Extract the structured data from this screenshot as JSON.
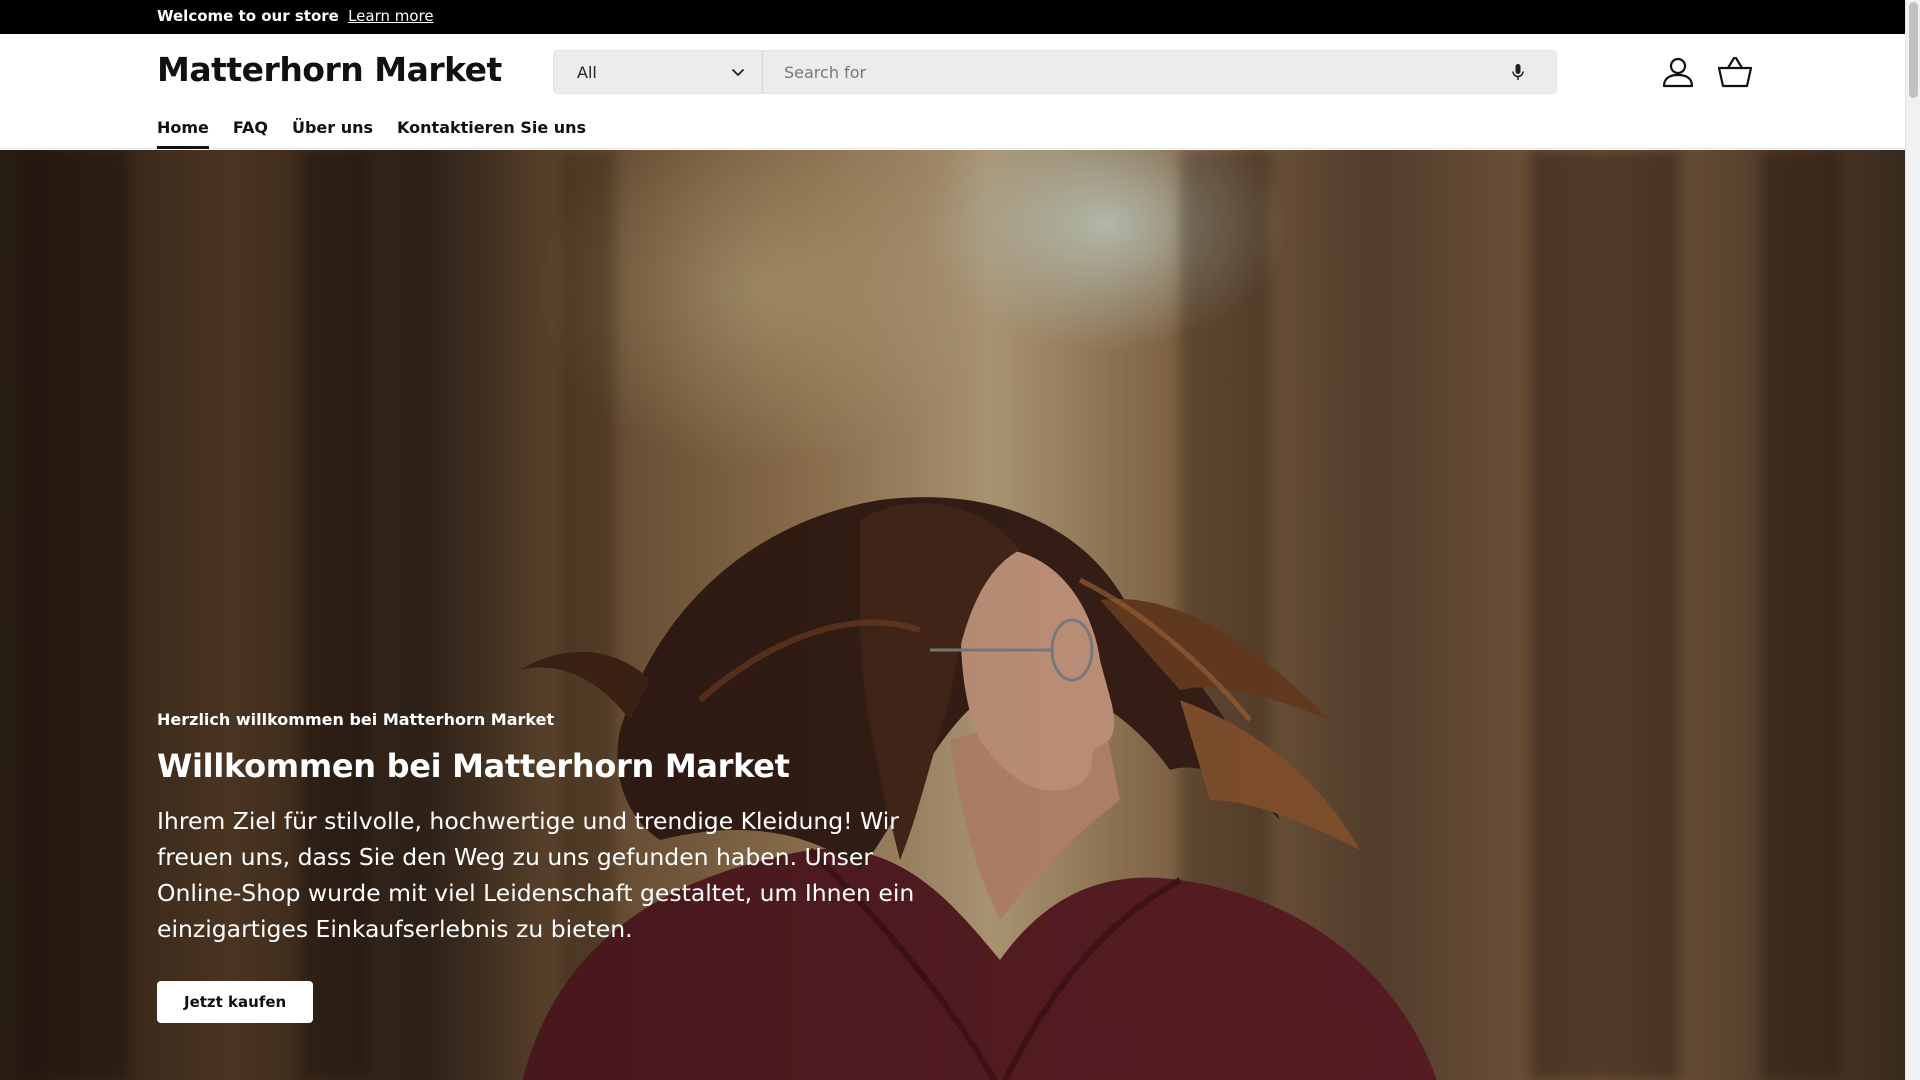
{
  "announcement": {
    "text": "Welcome to our store",
    "link": "Learn more"
  },
  "header": {
    "logo": "Matterhorn Market",
    "search": {
      "category": "All",
      "placeholder": "Search for"
    },
    "icons": [
      "account-icon",
      "basket-icon",
      "microphone-icon",
      "chevron-down-icon"
    ]
  },
  "nav": {
    "items": [
      {
        "label": "Home",
        "active": true
      },
      {
        "label": "FAQ"
      },
      {
        "label": "Über uns"
      },
      {
        "label": "Kontaktieren Sie uns"
      }
    ]
  },
  "hero": {
    "eyebrow": "Herzlich willkommen bei Matterhorn Market",
    "title": "Willkommen bei Matterhorn Market",
    "body": "Ihrem Ziel für stilvolle, hochwertige und trendige Kleidung! Wir freuen uns, dass Sie den Weg zu uns gefunden haben. Unser Online-Shop wurde mit viel Leidenschaft gestaltet, um Ihnen ein einzigartiges Einkaufserlebnis zu bieten.",
    "button": "Jetzt kaufen"
  },
  "colors": {
    "announcement_bg": "#000000",
    "search_bg": "#ececec",
    "button_bg": "#ffffff"
  }
}
